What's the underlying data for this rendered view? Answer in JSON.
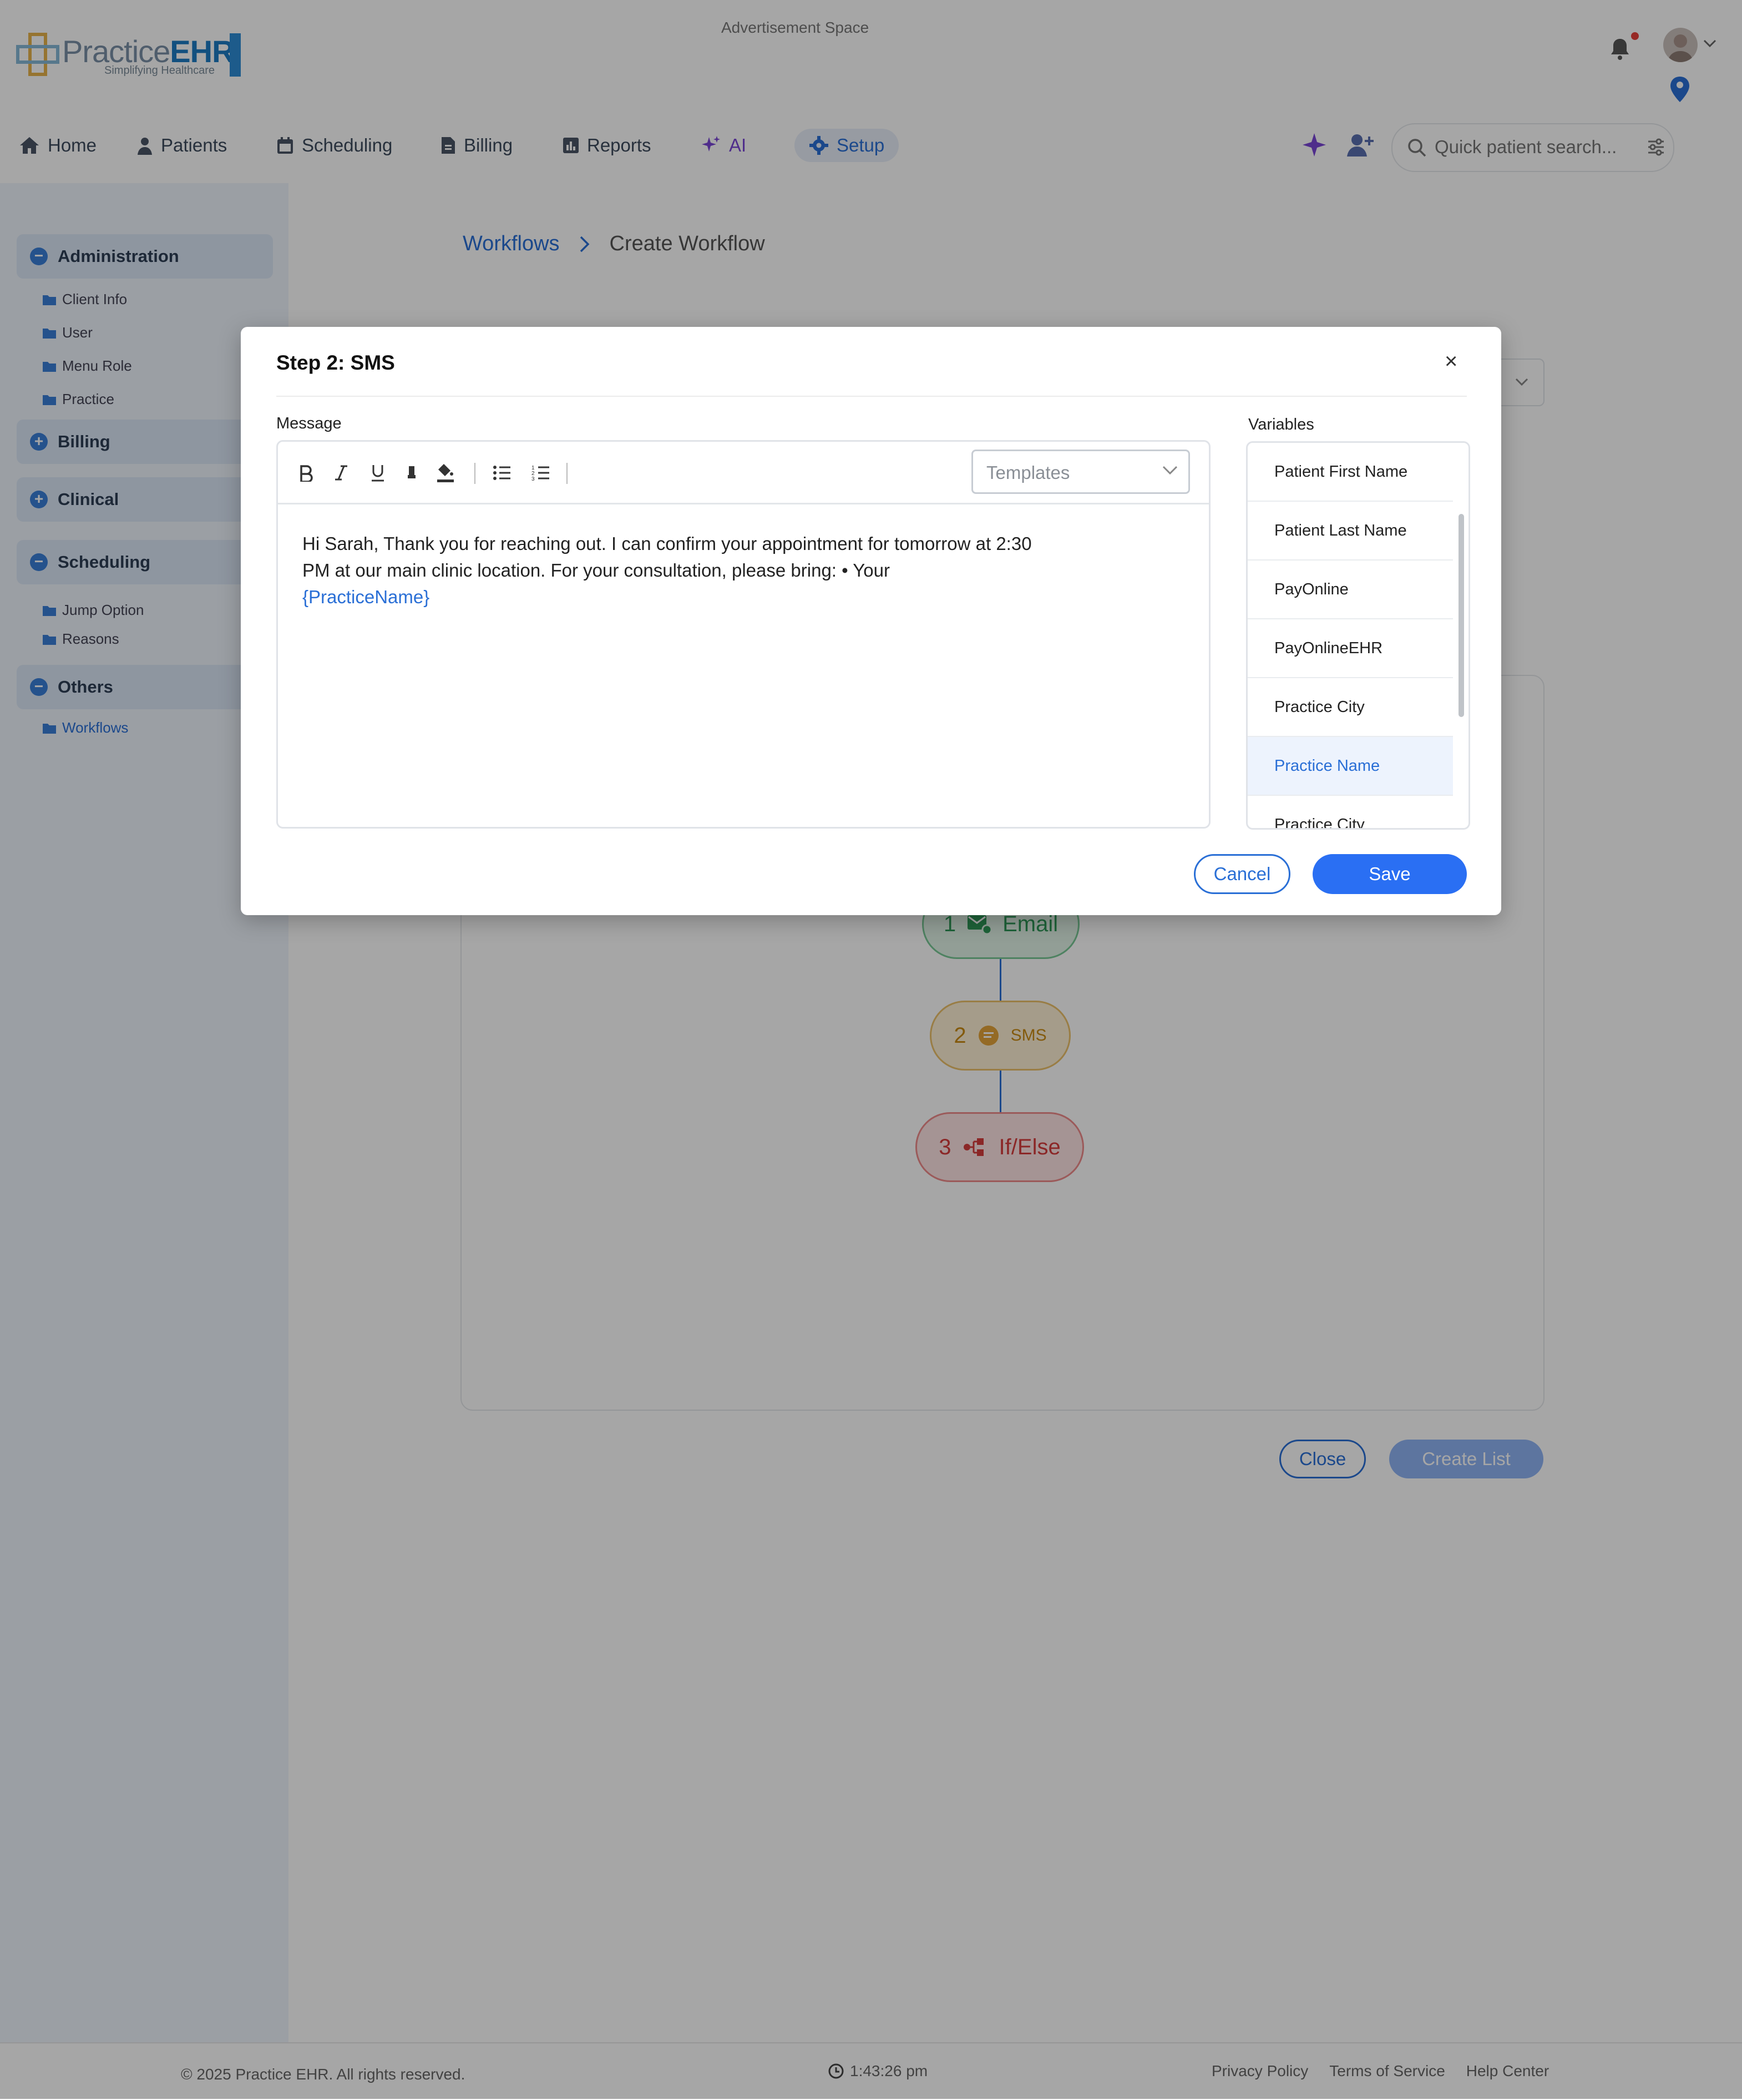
{
  "ad": {
    "label": "Advertisement Space"
  },
  "logo": {
    "text_a": "Practice",
    "text_b": "EHR",
    "tagline": "Simplifying Healthcare"
  },
  "nav": {
    "items": [
      {
        "label": "Home",
        "icon": "home-icon"
      },
      {
        "label": "Patients",
        "icon": "person-icon"
      },
      {
        "label": "Scheduling",
        "icon": "calendar-icon"
      },
      {
        "label": "Billing",
        "icon": "document-icon"
      },
      {
        "label": "Reports",
        "icon": "chart-icon"
      },
      {
        "label": "AI",
        "icon": "sparkle-icon"
      },
      {
        "label": "Setup",
        "icon": "gear-icon",
        "active": true
      }
    ]
  },
  "search": {
    "placeholder": "Quick patient search..."
  },
  "sidebar": {
    "groups": [
      {
        "label": "Administration",
        "items": [
          "Client Info",
          "User",
          "Menu Role",
          "Practice"
        ]
      },
      {
        "label": "Billing",
        "items": []
      },
      {
        "label": "Clinical",
        "items": []
      },
      {
        "label": "Scheduling",
        "items": [
          "Jump Option",
          "Reasons"
        ]
      },
      {
        "label": "Others",
        "items": [
          "Workflows"
        ]
      }
    ]
  },
  "breadcrumb": {
    "parent": "Workflows",
    "current": "Create Workflow"
  },
  "workflow": {
    "nodes": [
      {
        "num": "1",
        "label": "Email"
      },
      {
        "num": "2",
        "label": "SMS"
      },
      {
        "num": "3",
        "label": "If/Else"
      }
    ],
    "close_label": "Close",
    "create_label": "Create List"
  },
  "modal": {
    "title": "Step 2: SMS",
    "close_symbol": "×",
    "message_label": "Message",
    "variables_label": "Variables",
    "templates_placeholder": "Templates",
    "message_text": "Hi Sarah, Thank you for reaching out. I can confirm your appointment for tomorrow at 2:30 PM at our main clinic location. For your consultation, please bring: • Your",
    "message_variable": "{PracticeName}",
    "variables": [
      "Patient First Name",
      "Patient Last Name",
      "PayOnline",
      "PayOnlineEHR",
      "Practice City",
      "Practice Name",
      "Practice City"
    ],
    "selected_variable": "Practice Name",
    "cancel_label": "Cancel",
    "save_label": "Save"
  },
  "footer": {
    "copyright": "© 2025 Practice EHR. All rights reserved.",
    "time": "1:43:26 pm",
    "links": [
      "Privacy Policy",
      "Terms of Service",
      "Help Center"
    ]
  },
  "colors": {
    "primary": "#2a6ff3",
    "accent_ai": "#7a45d6",
    "email": "#2f9958",
    "sms": "#c98b14",
    "ifelse": "#d63d3d"
  }
}
